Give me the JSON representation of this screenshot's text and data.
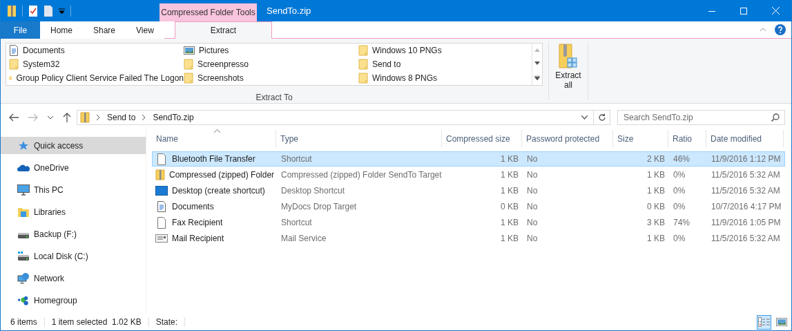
{
  "window": {
    "title": "SendTo.zip",
    "context_tab": "Compressed Folder Tools"
  },
  "tabs": [
    {
      "label": "File",
      "kind": "file",
      "selected": false
    },
    {
      "label": "Home",
      "kind": "tab",
      "selected": false
    },
    {
      "label": "Share",
      "kind": "tab",
      "selected": false
    },
    {
      "label": "View",
      "kind": "tab",
      "selected": false
    },
    {
      "label": "Extract",
      "kind": "context",
      "selected": true
    }
  ],
  "ribbon": {
    "extract_to": [
      {
        "label": "Documents",
        "kind": "document"
      },
      {
        "label": "Pictures",
        "kind": "pictures"
      },
      {
        "label": "Windows 10 PNGs",
        "kind": "folder"
      },
      {
        "label": "System32",
        "kind": "folder"
      },
      {
        "label": "Screenpresso",
        "kind": "folder"
      },
      {
        "label": "Send to",
        "kind": "folder"
      },
      {
        "label": "Group Policy Client Service Failed The Logon",
        "kind": "folder"
      },
      {
        "label": "Screenshots",
        "kind": "folder"
      },
      {
        "label": "Windows 8 PNGs",
        "kind": "folder"
      }
    ],
    "group_label": "Extract To",
    "extract_all": "Extract all"
  },
  "address": {
    "crumbs": [
      "Send to",
      "SendTo.zip"
    ]
  },
  "search": {
    "placeholder": "Search SendTo.zip"
  },
  "navigation": [
    {
      "label": "Quick access",
      "kind": "star",
      "selected": true
    },
    {
      "label": "OneDrive",
      "kind": "cloud",
      "selected": false
    },
    {
      "label": "This PC",
      "kind": "pc",
      "selected": false
    },
    {
      "label": "Libraries",
      "kind": "library",
      "selected": false
    },
    {
      "label": "Backup (F:)",
      "kind": "drive",
      "selected": false
    },
    {
      "label": "Local Disk (C:)",
      "kind": "system-drive",
      "selected": false
    },
    {
      "label": "Network",
      "kind": "network",
      "selected": false
    },
    {
      "label": "Homegroup",
      "kind": "homegroup",
      "selected": false
    }
  ],
  "table": {
    "columns": [
      {
        "label": "Name",
        "sorted": true
      },
      {
        "label": "Type",
        "sorted": false
      },
      {
        "label": "Compressed size",
        "sorted": false
      },
      {
        "label": "Password protected",
        "sorted": false
      },
      {
        "label": "Size",
        "sorted": false
      },
      {
        "label": "Ratio",
        "sorted": false
      },
      {
        "label": "Date modified",
        "sorted": false
      }
    ],
    "rows": [
      {
        "kind": "blank",
        "selected": true,
        "cells": [
          "Bluetooth File Transfer",
          "Shortcut",
          "1 KB",
          "No",
          "2 KB",
          "46%",
          "11/9/2016 1:12 PM"
        ]
      },
      {
        "kind": "zip",
        "selected": false,
        "cells": [
          "Compressed (zipped) Folder",
          "Compressed (zipped) Folder SendTo Target",
          "1 KB",
          "No",
          "1 KB",
          "0%",
          "11/5/2016 5:32 AM"
        ]
      },
      {
        "kind": "desktop",
        "selected": false,
        "cells": [
          "Desktop (create shortcut)",
          "Desktop Shortcut",
          "1 KB",
          "No",
          "1 KB",
          "0%",
          "11/5/2016 5:32 AM"
        ]
      },
      {
        "kind": "document",
        "selected": false,
        "cells": [
          "Documents",
          "MyDocs Drop Target",
          "0 KB",
          "No",
          "0 KB",
          "0%",
          "10/7/2016 4:17 PM"
        ]
      },
      {
        "kind": "blank",
        "selected": false,
        "cells": [
          "Fax Recipient",
          "Shortcut",
          "1 KB",
          "No",
          "3 KB",
          "74%",
          "11/9/2016 1:05 PM"
        ]
      },
      {
        "kind": "mail",
        "selected": false,
        "cells": [
          "Mail Recipient",
          "Mail Service",
          "1 KB",
          "No",
          "1 KB",
          "0%",
          "11/5/2016 5:32 AM"
        ]
      }
    ]
  },
  "status_bar": {
    "items": [
      "6 items",
      "1 item selected  1.02 KB",
      "State:"
    ],
    "views": [
      {
        "kind": "details",
        "selected": true
      },
      {
        "kind": "large-icons",
        "selected": false
      }
    ]
  }
}
